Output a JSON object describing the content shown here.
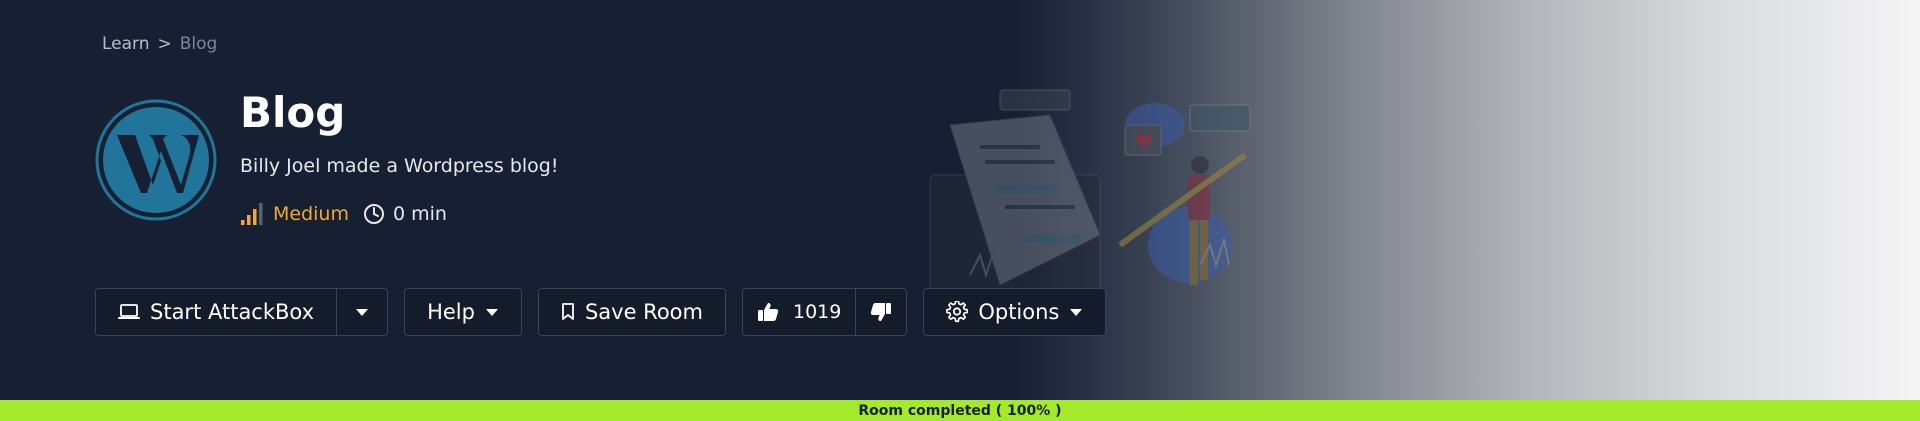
{
  "breadcrumb": {
    "parent": "Learn",
    "separator": ">",
    "current": "Blog"
  },
  "room": {
    "title": "Blog",
    "description": "Billy Joel made a Wordpress blog!",
    "difficulty": "Medium",
    "duration": "0 min"
  },
  "actions": {
    "start_attackbox": "Start AttackBox",
    "help": "Help",
    "save_room": "Save Room",
    "likes": "1019",
    "options": "Options"
  },
  "status": {
    "text": "Room completed ( 100% )",
    "progress_percent": 100
  },
  "colors": {
    "background": "#172033",
    "accent_difficulty": "#f0a830",
    "progress": "#a3ea2a",
    "wordpress_blue": "#21759b"
  },
  "icons": {
    "logo": "wordpress-logo",
    "difficulty": "signal-bars-icon",
    "duration": "clock-icon",
    "attackbox": "laptop-icon",
    "dropdown": "caret-down-icon",
    "save": "bookmark-icon",
    "like": "thumbs-up-icon",
    "dislike": "thumbs-down-icon",
    "options": "gear-icon"
  }
}
